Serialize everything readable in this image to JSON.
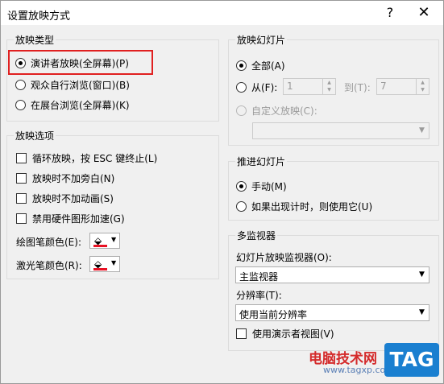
{
  "title": "设置放映方式",
  "title_buttons": {
    "help": "?",
    "close": "✕"
  },
  "show_type": {
    "title": "放映类型",
    "options": [
      {
        "label": "演讲者放映(全屏幕)(P)",
        "selected": true
      },
      {
        "label": "观众自行浏览(窗口)(B)",
        "selected": false
      },
      {
        "label": "在展台浏览(全屏幕)(K)",
        "selected": false
      }
    ]
  },
  "show_options": {
    "title": "放映选项",
    "checkboxes": [
      {
        "label": "循环放映，按 ESC 键终止(L)",
        "checked": false
      },
      {
        "label": "放映时不加旁白(N)",
        "checked": false
      },
      {
        "label": "放映时不加动画(S)",
        "checked": false
      },
      {
        "label": "禁用硬件图形加速(G)",
        "checked": false
      }
    ],
    "pen_color_label": "绘图笔颜色(E):",
    "laser_color_label": "激光笔颜色(R):",
    "pen_color": "#e81123",
    "laser_color": "#e81123"
  },
  "slides": {
    "title": "放映幻灯片",
    "all_label": "全部(A)",
    "from_label": "从(F):",
    "from_value": "1",
    "to_label": "到(T):",
    "to_value": "7",
    "custom_label": "自定义放映(C):",
    "custom_value": ""
  },
  "advance": {
    "title": "推进幻灯片",
    "manual_label": "手动(M)",
    "timing_label": "如果出现计时，则使用它(U)"
  },
  "monitors": {
    "title": "多监视器",
    "monitor_label": "幻灯片放映监视器(O):",
    "monitor_value": "主监视器",
    "resolution_label": "分辨率(T):",
    "resolution_value": "使用当前分辨率",
    "presenter_view_label": "使用演示者视图(V)"
  },
  "watermark": {
    "line1": "电脑技术网",
    "line2": "www.tagxp.com",
    "tag": "TAG"
  },
  "colors": {
    "highlight": "#e02020",
    "dialog_bg": "#f0f0f0"
  }
}
